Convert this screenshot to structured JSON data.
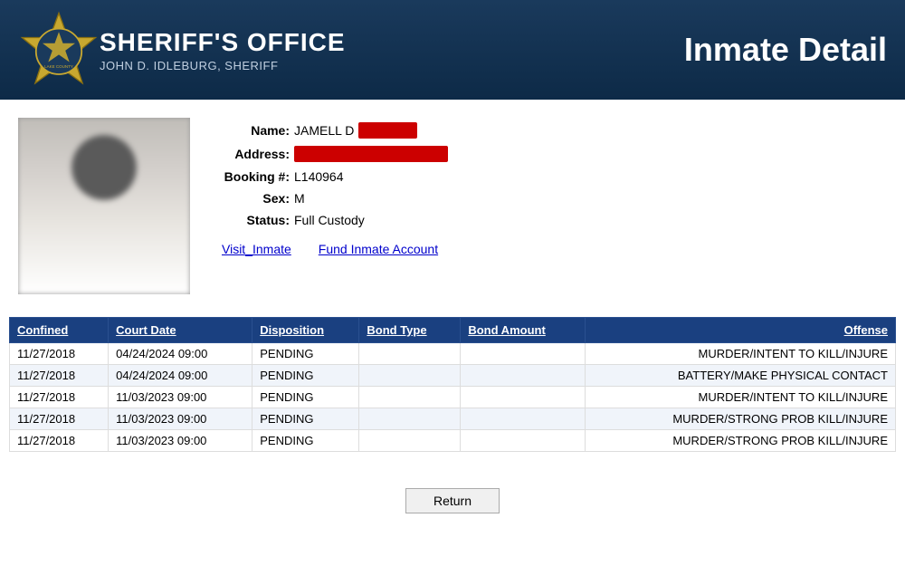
{
  "header": {
    "agency_name": "SHERIFF'S OFFICE",
    "sheriff_name": "JOHN D. IDLEBURG, SHERIFF",
    "page_title": "Inmate Detail"
  },
  "inmate": {
    "name_label": "Name:",
    "name_value": "JAMELL D",
    "address_label": "Address:",
    "booking_label": "Booking #:",
    "booking_value": "L140964",
    "sex_label": "Sex:",
    "sex_value": "M",
    "status_label": "Status:",
    "status_value": "Full Custody",
    "link_visit": "Visit_Inmate",
    "link_fund": "Fund Inmate Account"
  },
  "table": {
    "columns": [
      "Confined",
      "Court Date",
      "Disposition",
      "Bond Type",
      "Bond Amount",
      "Offense"
    ],
    "rows": [
      {
        "confined": "11/27/2018",
        "court_date": "04/24/2024 09:00",
        "disposition": "PENDING",
        "bond_type": "",
        "bond_amount": "",
        "offense": "MURDER/INTENT TO KILL/INJURE"
      },
      {
        "confined": "11/27/2018",
        "court_date": "04/24/2024 09:00",
        "disposition": "PENDING",
        "bond_type": "",
        "bond_amount": "",
        "offense": "BATTERY/MAKE PHYSICAL CONTACT"
      },
      {
        "confined": "11/27/2018",
        "court_date": "11/03/2023 09:00",
        "disposition": "PENDING",
        "bond_type": "",
        "bond_amount": "",
        "offense": "MURDER/INTENT TO KILL/INJURE"
      },
      {
        "confined": "11/27/2018",
        "court_date": "11/03/2023 09:00",
        "disposition": "PENDING",
        "bond_type": "",
        "bond_amount": "",
        "offense": "MURDER/STRONG PROB KILL/INJURE"
      },
      {
        "confined": "11/27/2018",
        "court_date": "11/03/2023 09:00",
        "disposition": "PENDING",
        "bond_type": "",
        "bond_amount": "",
        "offense": "MURDER/STRONG PROB KILL/INJURE"
      }
    ]
  },
  "buttons": {
    "return_label": "Return"
  },
  "colors": {
    "header_bg": "#1a3a5c",
    "table_header_bg": "#1a4080",
    "redacted_bg": "#cc0000"
  }
}
